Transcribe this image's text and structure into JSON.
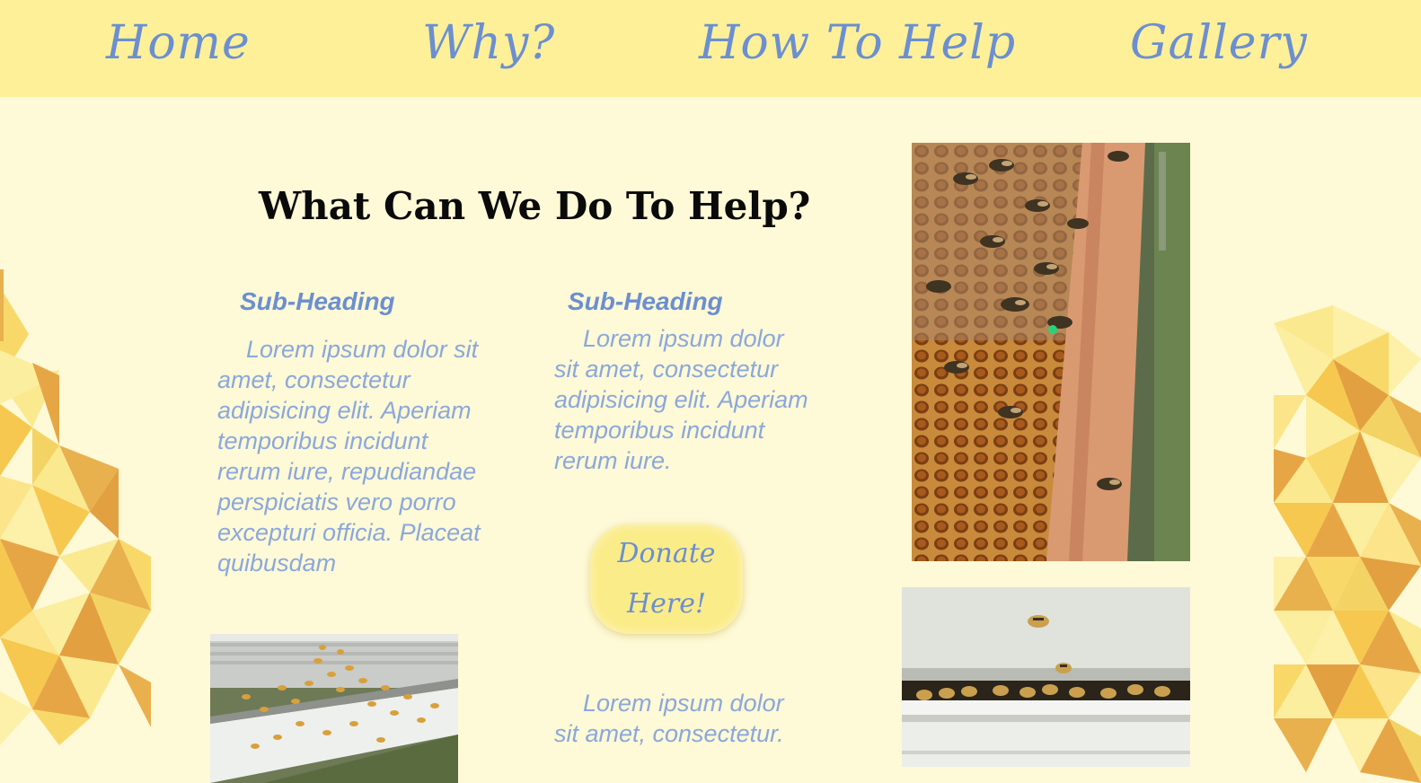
{
  "nav": {
    "home": "Home",
    "why": "Why?",
    "how_to_help": "How To Help",
    "gallery": "Gallery"
  },
  "main": {
    "heading": "What Can We Do To Help?",
    "col1": {
      "subheading": "Sub-Heading",
      "body": "Lorem ipsum dolor sit amet, consectetur adipisicing elit. Aperiam temporibus incidunt rerum iure, repudiandae perspiciatis vero porro excepturi officia. Placeat quibusdam"
    },
    "col2": {
      "subheading": "Sub-Heading",
      "body": "Lorem ipsum dolor sit amet, consectetur adipisicing elit. Aperiam temporibus incidunt rerum iure."
    },
    "donate_label": "Donate Here!",
    "footer_text": "Lorem ipsum dolor sit amet, consectetur."
  },
  "colors": {
    "nav_bg": "#fdf099",
    "page_bg": "#fef9d6",
    "link_blue": "#6b8fd0",
    "body_blue": "#8aa8dc",
    "button_yellow": "#fbec8a"
  },
  "images": {
    "honeycomb_bees": "honeycomb-with-bees-photo",
    "hive_box_bees": "beehive-box-bees-photo",
    "hive_entrance_bees": "hive-entrance-bees-photo",
    "hex_pattern": "honeycomb-hexagon-pattern"
  }
}
